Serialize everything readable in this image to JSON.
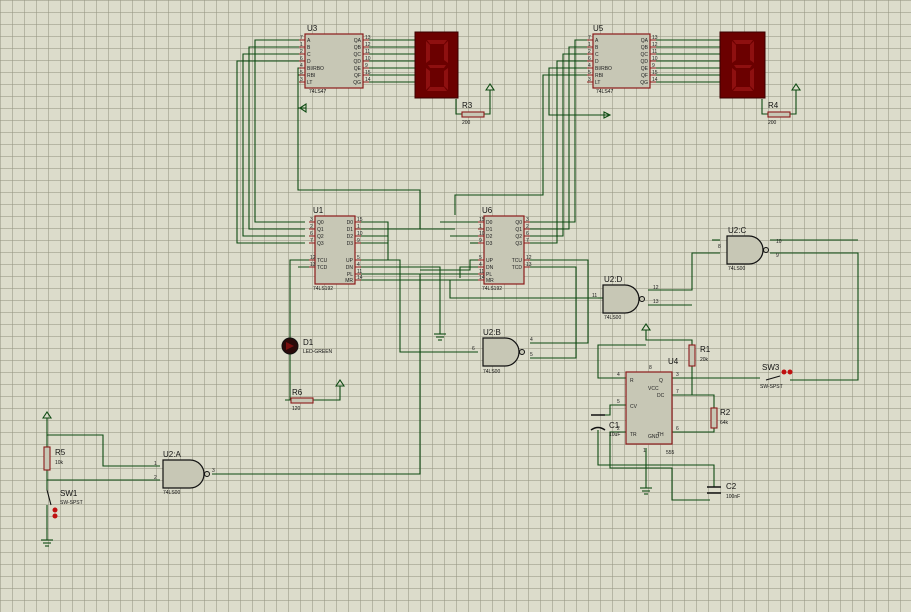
{
  "components": {
    "u3": {
      "ref": "U3",
      "part": "74LS47",
      "pins_left": [
        "A",
        "B",
        "C",
        "D",
        "BI/RBO",
        "RBI",
        "LT"
      ],
      "nums_left": [
        "7",
        "1",
        "2",
        "6",
        "4",
        "5",
        "3"
      ],
      "pins_right": [
        "QA",
        "QB",
        "QC",
        "QD",
        "QE",
        "QF",
        "QG"
      ],
      "nums_right": [
        "13",
        "12",
        "11",
        "10",
        "9",
        "15",
        "14"
      ]
    },
    "u5": {
      "ref": "U5",
      "part": "74LS47",
      "pins_left": [
        "A",
        "B",
        "C",
        "D",
        "BI/RBO",
        "RBI",
        "LT"
      ],
      "nums_left": [
        "7",
        "1",
        "2",
        "6",
        "4",
        "5",
        "3"
      ],
      "pins_right": [
        "QA",
        "QB",
        "QC",
        "QD",
        "QE",
        "QF",
        "QG"
      ],
      "nums_right": [
        "13",
        "12",
        "11",
        "10",
        "9",
        "15",
        "14"
      ]
    },
    "u1": {
      "ref": "U1",
      "part": "74LS192",
      "pins_left": [
        "Q0",
        "Q1",
        "Q2",
        "Q3",
        "TCU",
        "TCD"
      ],
      "nums_left": [
        "3",
        "2",
        "6",
        "7",
        "12",
        "13"
      ],
      "pins_right": [
        "D0",
        "D1",
        "D2",
        "D3",
        "UP",
        "DN",
        "PL",
        "MR"
      ],
      "nums_right": [
        "15",
        "1",
        "10",
        "9",
        "5",
        "4",
        "11",
        "14"
      ]
    },
    "u6": {
      "ref": "U6",
      "part": "74LS192",
      "pins_left": [
        "D0",
        "D1",
        "D2",
        "D3",
        "UP",
        "DN",
        "PL",
        "MR"
      ],
      "nums_left": [
        "15",
        "1",
        "10",
        "9",
        "5",
        "4",
        "11",
        "14"
      ],
      "pins_right": [
        "Q0",
        "Q1",
        "Q2",
        "Q3",
        "TCU",
        "TCD"
      ],
      "nums_right": [
        "3",
        "2",
        "6",
        "7",
        "12",
        "13"
      ]
    },
    "u4": {
      "ref": "U4",
      "part": "555",
      "pins": [
        "R",
        "VCC",
        "Q",
        "DC",
        "CV",
        "TR",
        "GND",
        "TH"
      ],
      "nums": [
        "4",
        "8",
        "3",
        "7",
        "5",
        "2",
        "1",
        "6"
      ]
    },
    "r1": {
      "ref": "R1",
      "value": "20k"
    },
    "r2": {
      "ref": "R2",
      "value": "64k"
    },
    "r3": {
      "ref": "R3",
      "value": "200"
    },
    "r4": {
      "ref": "R4",
      "value": "200"
    },
    "r5": {
      "ref": "R5",
      "value": "10k"
    },
    "r6": {
      "ref": "R6",
      "value": "120"
    },
    "c1": {
      "ref": "C1",
      "value": "10uF"
    },
    "c2": {
      "ref": "C2",
      "value": "100nF"
    },
    "d1": {
      "ref": "D1",
      "value": "LED-GREEN"
    },
    "sw1": {
      "ref": "SW1",
      "value": "SW-SPST"
    },
    "sw3": {
      "ref": "SW3",
      "value": "SW-SPST"
    },
    "u2a": {
      "ref": "U2:A",
      "part": "74LS00",
      "nums": [
        "1",
        "2",
        "3"
      ]
    },
    "u2b": {
      "ref": "U2:B",
      "part": "74LS00",
      "nums": [
        "4",
        "5",
        "6"
      ]
    },
    "u2c": {
      "ref": "U2:C",
      "part": "74LS00",
      "nums": [
        "8",
        "9",
        "10"
      ]
    },
    "u2d": {
      "ref": "U2:D",
      "part": "74LS00",
      "nums": [
        "11",
        "12",
        "13"
      ]
    }
  },
  "colors": {
    "wire": "#0d4a12",
    "chip_border": "#8b1a1a",
    "chip_fill": "#c7c7b5",
    "display": "#6b0000",
    "grid": "#dcdccb"
  },
  "icons": {
    "ground": "ground-icon",
    "power": "power-arrow-icon"
  }
}
